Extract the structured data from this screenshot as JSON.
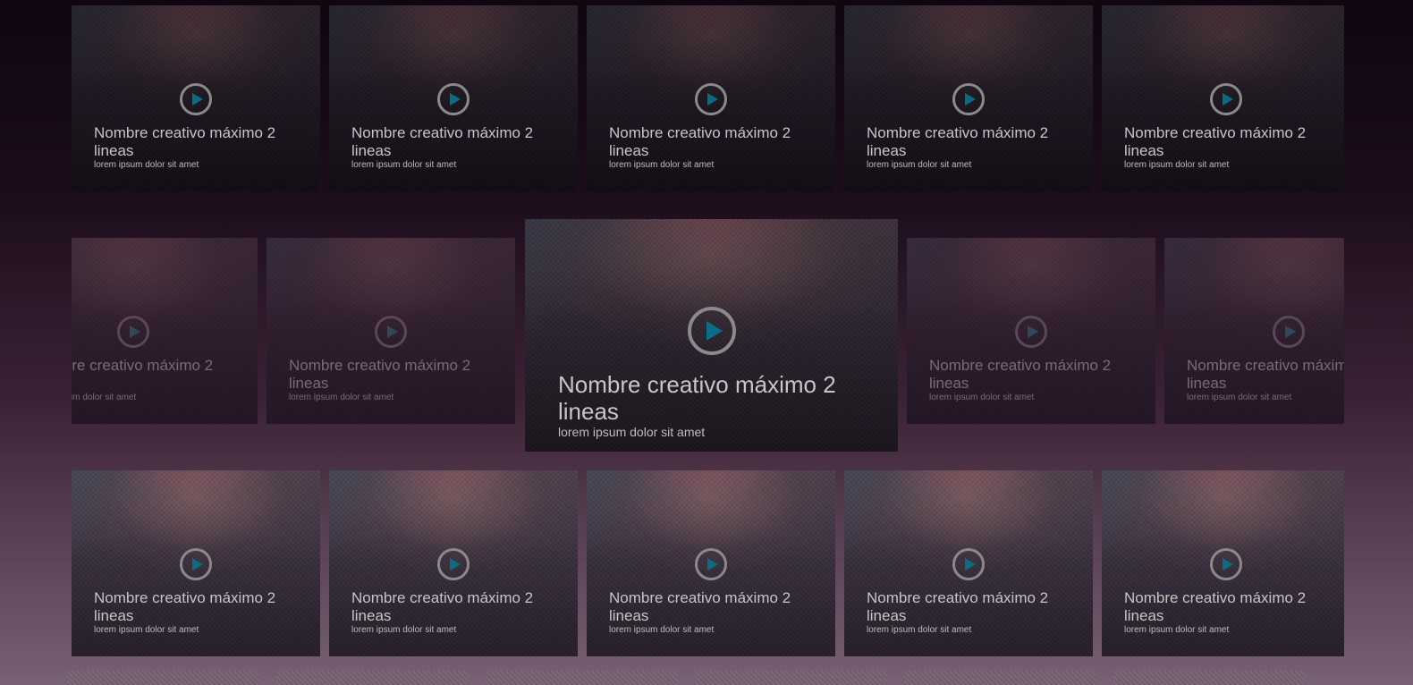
{
  "cards": {
    "title": "Nombre creativo máximo 2 lineas",
    "subtitle": "lorem ipsum dolor sit amet"
  },
  "featured": {
    "title": "Nombre creativo máximo 2 lineas",
    "subtitle": "lorem ipsum dolor sit amet"
  },
  "icons": {
    "play": "play-icon"
  },
  "colors": {
    "play_accent": "#0b6c86",
    "background_top": "#0f0610",
    "background_bottom": "#786174"
  }
}
